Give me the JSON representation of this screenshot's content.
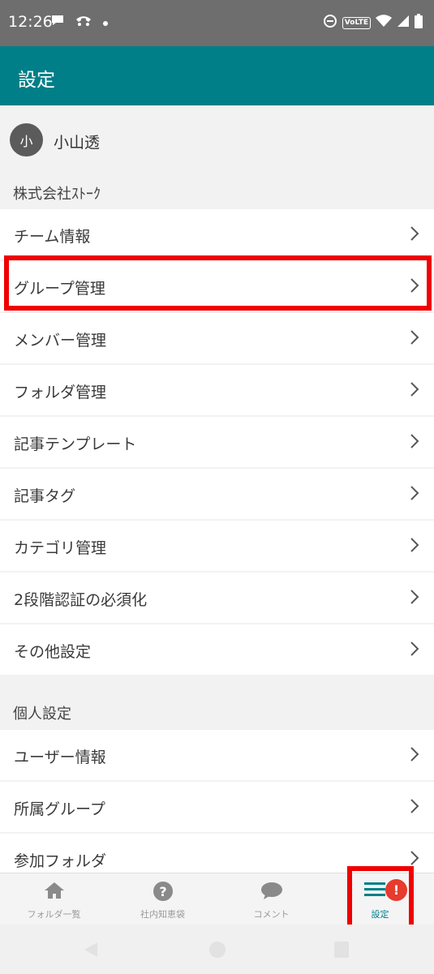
{
  "status_bar": {
    "time": "12:26",
    "left_icons": [
      "chat-bubble-icon",
      "call-icon",
      "dot-icon"
    ],
    "right_icons": [
      "dnd-icon",
      "volte-badge",
      "wifi-icon",
      "signal-icon",
      "battery-icon"
    ],
    "volte_label": "VoLTE"
  },
  "appbar": {
    "title": "設定",
    "color": "#007f88"
  },
  "user": {
    "avatar_initial": "小",
    "name": "小山透"
  },
  "sections": [
    {
      "header": "株式会社ｽﾄｰｸ",
      "items": [
        {
          "label": "チーム情報"
        },
        {
          "label": "グループ管理"
        },
        {
          "label": "メンバー管理"
        },
        {
          "label": "フォルダ管理"
        },
        {
          "label": "記事テンプレート"
        },
        {
          "label": "記事タグ"
        },
        {
          "label": "カテゴリ管理"
        },
        {
          "label": "2段階認証の必須化"
        },
        {
          "label": "その他設定"
        }
      ]
    },
    {
      "header": "個人設定",
      "items": [
        {
          "label": "ユーザー情報"
        },
        {
          "label": "所属グループ"
        },
        {
          "label": "参加フォルダ"
        }
      ]
    }
  ],
  "bottom_nav": {
    "items": [
      {
        "label": "フォルダ一覧",
        "icon": "home-icon"
      },
      {
        "label": "社内知恵袋",
        "icon": "question-icon"
      },
      {
        "label": "コメント",
        "icon": "comment-icon"
      },
      {
        "label": "設定",
        "icon": "menu-icon",
        "badge": "!"
      }
    ]
  },
  "colors": {
    "accent": "#007f88",
    "highlight": "#ef0000",
    "badge": "#e63b2e"
  }
}
